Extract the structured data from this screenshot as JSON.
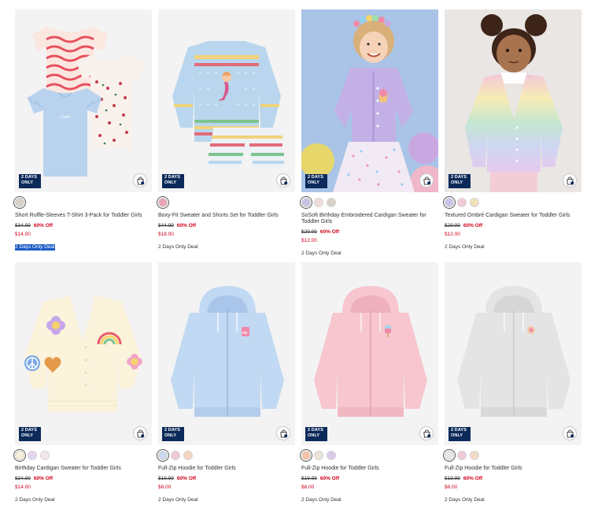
{
  "colors": {
    "badge_bg": "#0b2a5a",
    "sale_red": "#d0021b",
    "highlight": "#1f5cc6"
  },
  "products": [
    {
      "badge": "2 DAYS ONLY",
      "swatches": [
        "#d9d2c6"
      ],
      "name": "Short Ruffle-Sleeves T-Shirt 3-Pack for Toddler Girls",
      "was_price": "$34.99",
      "discount": "60% Off",
      "price": "$14.00",
      "deal_label": "2 Days Only Deal",
      "image": "tshirt-3-pack"
    },
    {
      "badge": "2 DAYS ONLY",
      "swatches": [
        "#e8a4b4"
      ],
      "name": "Boxy-Fit Sweater and Shorts Set for Toddler Girls",
      "was_price": "$44.99",
      "discount": "60% Off",
      "price": "$18.00",
      "deal_label": "2 Days Only Deal",
      "image": "sweater-shorts-set"
    },
    {
      "badge": "2 DAYS ONLY",
      "swatches": [
        "#c8c2e6",
        "#f1dcdc",
        "#d9d2c6"
      ],
      "name": "SoSoft Birthday Embroidered Cardigan Sweater for Toddler Girls",
      "was_price": "$29.99",
      "discount": "60% Off",
      "price": "$12.00",
      "deal_label": "2 Days Only Deal",
      "image": "girl-lavender-cardigan"
    },
    {
      "badge": "2 DAYS ONLY",
      "swatches": [
        "#c8c2e6",
        "#f1c9d6",
        "#f0e2b8"
      ],
      "name": "Textured Ombré Cardigan Sweater for Toddler Girls",
      "was_price": "$29.99",
      "discount": "60% Off",
      "price": "$12.00",
      "deal_label": "2 Days Only Deal",
      "image": "girl-rainbow-cardigan"
    },
    {
      "badge": "2 DAYS ONLY",
      "swatches": [
        "#f6efd9",
        "#e6d7ef",
        "#f3e6e6"
      ],
      "name": "Birthday Cardigan Sweater for Toddler Girls",
      "was_price": "$34.99",
      "discount": "60% Off",
      "price": "$14.00",
      "deal_label": "2 Days Only Deal",
      "image": "patch-cardigan"
    },
    {
      "badge": "2 DAYS ONLY",
      "swatches": [
        "#c9d9f0",
        "#f1c9d6",
        "#f5d4c0"
      ],
      "name": "Full-Zip Hoodie for Toddler Girls",
      "was_price": "$19.99",
      "discount": "60% Off",
      "price": "$8.00",
      "deal_label": "2 Days Only Deal",
      "image": "blue-hoodie"
    },
    {
      "badge": "2 DAYS ONLY",
      "swatches": [
        "#f5c2a8",
        "#ece4d8",
        "#d8cbe8"
      ],
      "name": "Full-Zip Hoodie for Toddler Girls",
      "was_price": "$19.99",
      "discount": "60% Off",
      "price": "$8.00",
      "deal_label": "2 Days Only Deal",
      "image": "pink-hoodie"
    },
    {
      "badge": "2 DAYS ONLY",
      "swatches": [
        "#e6e6e6",
        "#f1c9d6",
        "#f0dcc6"
      ],
      "name": "Full-Zip Hoodie for Toddler Girls",
      "was_price": "$19.99",
      "discount": "60% Off",
      "price": "$8.00",
      "deal_label": "2 Days Only Deal",
      "image": "grey-hoodie"
    }
  ]
}
